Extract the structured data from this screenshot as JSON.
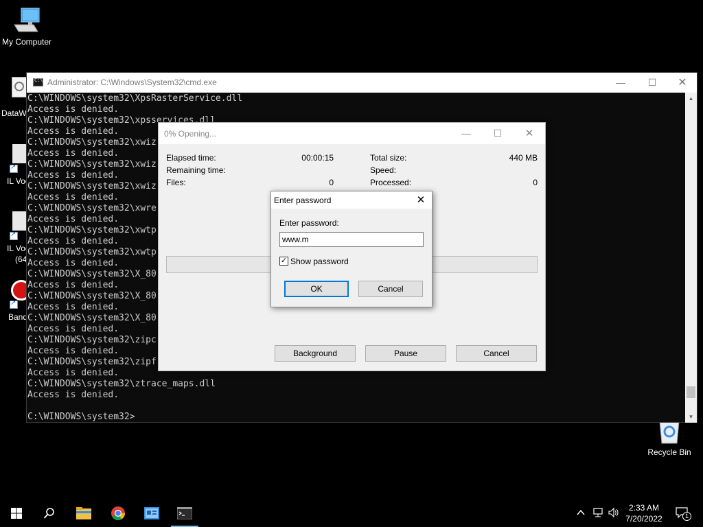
{
  "desktop": {
    "icons": [
      {
        "label": "My Computer"
      },
      {
        "label": "DataW"
      },
      {
        "label": "IL Voc"
      },
      {
        "label": "IL Voc"
      },
      {
        "label": "(64"
      },
      {
        "label": "Band"
      },
      {
        "label": "Recycle Bin"
      }
    ]
  },
  "cmd": {
    "title": "Administrator: C:\\Windows\\System32\\cmd.exe",
    "lines": [
      "C:\\WINDOWS\\system32\\XpsRasterService.dll",
      "Access is denied.",
      "C:\\WINDOWS\\system32\\xpsservices.dll",
      "Access is denied.",
      "C:\\WINDOWS\\system32\\xwiz",
      "Access is denied.",
      "C:\\WINDOWS\\system32\\xwiz",
      "Access is denied.",
      "C:\\WINDOWS\\system32\\xwiz",
      "Access is denied.",
      "C:\\WINDOWS\\system32\\xwre",
      "Access is denied.",
      "C:\\WINDOWS\\system32\\xwtp",
      "Access is denied.",
      "C:\\WINDOWS\\system32\\xwtp",
      "Access is denied.",
      "C:\\WINDOWS\\system32\\X_80",
      "Access is denied.",
      "C:\\WINDOWS\\system32\\X_80",
      "Access is denied.",
      "C:\\WINDOWS\\system32\\X_80",
      "Access is denied.",
      "C:\\WINDOWS\\system32\\zipc",
      "Access is denied.",
      "C:\\WINDOWS\\system32\\zipf",
      "Access is denied.",
      "C:\\WINDOWS\\system32\\ztrace_maps.dll",
      "Access is denied.",
      "",
      "C:\\WINDOWS\\system32>"
    ]
  },
  "progress": {
    "title": "0% Opening...",
    "elapsed_label": "Elapsed time:",
    "elapsed_value": "00:00:15",
    "remaining_label": "Remaining time:",
    "files_label": "Files:",
    "files_value": "0",
    "total_label": "Total size:",
    "total_value": "440 MB",
    "speed_label": "Speed:",
    "processed_label": "Processed:",
    "processed_value": "0",
    "percent": 0,
    "background_label": "Background",
    "pause_label": "Pause",
    "cancel_label": "Cancel"
  },
  "password_dialog": {
    "title": "Enter password",
    "field_label": "Enter password:",
    "value": "www.m",
    "show_password_label": "Show password",
    "show_password_checked": true,
    "ok_label": "OK",
    "cancel_label": "Cancel"
  },
  "taskbar": {
    "time": "2:33 AM",
    "date": "7/20/2022",
    "notification_count": "1",
    "apps": [
      "start",
      "search",
      "file-explorer",
      "chrome",
      "control-panel",
      "cmd"
    ]
  }
}
